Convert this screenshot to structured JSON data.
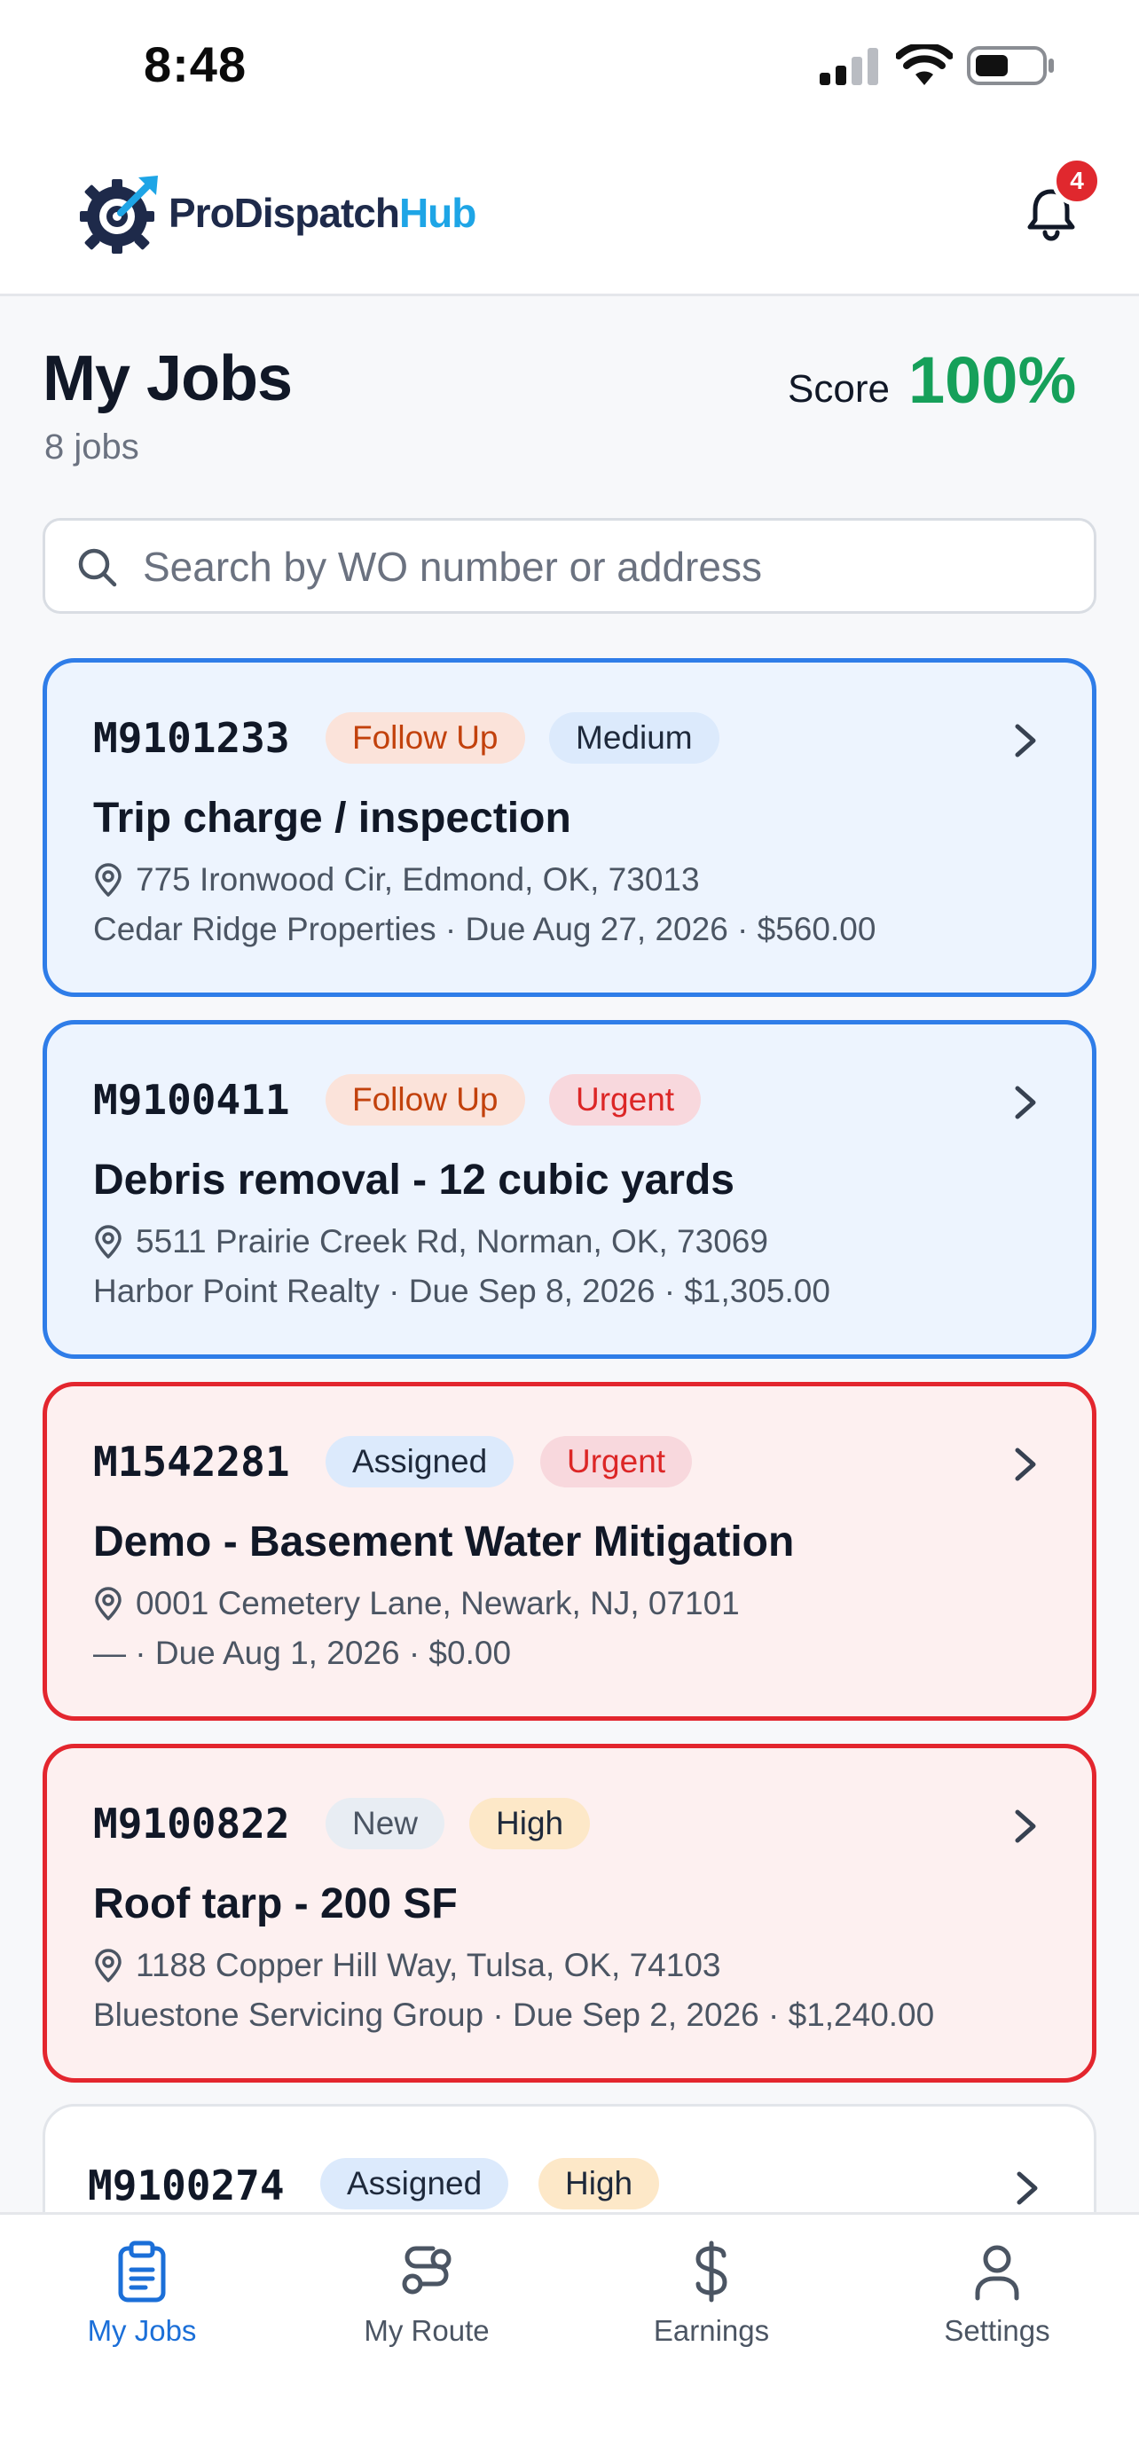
{
  "status_bar": {
    "time": "8:48"
  },
  "header": {
    "brand_main": "ProDispatch",
    "brand_accent": "Hub",
    "notification_count": "4"
  },
  "page": {
    "title": "My Jobs",
    "job_count": "8 jobs",
    "score_label": "Score",
    "score_value": "100%"
  },
  "search": {
    "placeholder": "Search by WO number or address"
  },
  "jobs": [
    {
      "wo": "M9101233",
      "status": "Follow Up",
      "priority": "Medium",
      "title": "Trip charge / inspection",
      "address": "775 Ironwood Cir, Edmond, OK, 73013",
      "meta": "Cedar Ridge Properties · Due Aug 27, 2026 · $560.00"
    },
    {
      "wo": "M9100411",
      "status": "Follow Up",
      "priority": "Urgent",
      "title": "Debris removal - 12 cubic yards",
      "address": "5511 Prairie Creek Rd, Norman, OK, 73069",
      "meta": "Harbor Point Realty · Due Sep 8, 2026 · $1,305.00"
    },
    {
      "wo": "M1542281",
      "status": "Assigned",
      "priority": "Urgent",
      "title": "Demo - Basement Water Mitigation",
      "address": "0001 Cemetery Lane, Newark, NJ, 07101",
      "meta": "— · Due Aug 1, 2026 · $0.00"
    },
    {
      "wo": "M9100822",
      "status": "New",
      "priority": "High",
      "title": "Roof tarp - 200 SF",
      "address": "1188 Copper Hill Way, Tulsa, OK, 74103",
      "meta": "Bluestone Servicing Group · Due Sep 2, 2026 · $1,240.00"
    },
    {
      "wo": "M9100274",
      "status": "Assigned",
      "priority": "High"
    }
  ],
  "nav": [
    {
      "label": "My Jobs",
      "icon": "clipboard-icon",
      "active": true
    },
    {
      "label": "My Route",
      "icon": "route-icon",
      "active": false
    },
    {
      "label": "Earnings",
      "icon": "dollar-icon",
      "active": false
    },
    {
      "label": "Settings",
      "icon": "user-icon",
      "active": false
    }
  ],
  "colors": {
    "accent_blue": "#1b6fd8",
    "card_blue_border": "#2f7de8",
    "card_red_border": "#e3262e",
    "score_green": "#16a05a",
    "badge_red": "#e0282e",
    "brand_cyan": "#1ea5e6"
  }
}
